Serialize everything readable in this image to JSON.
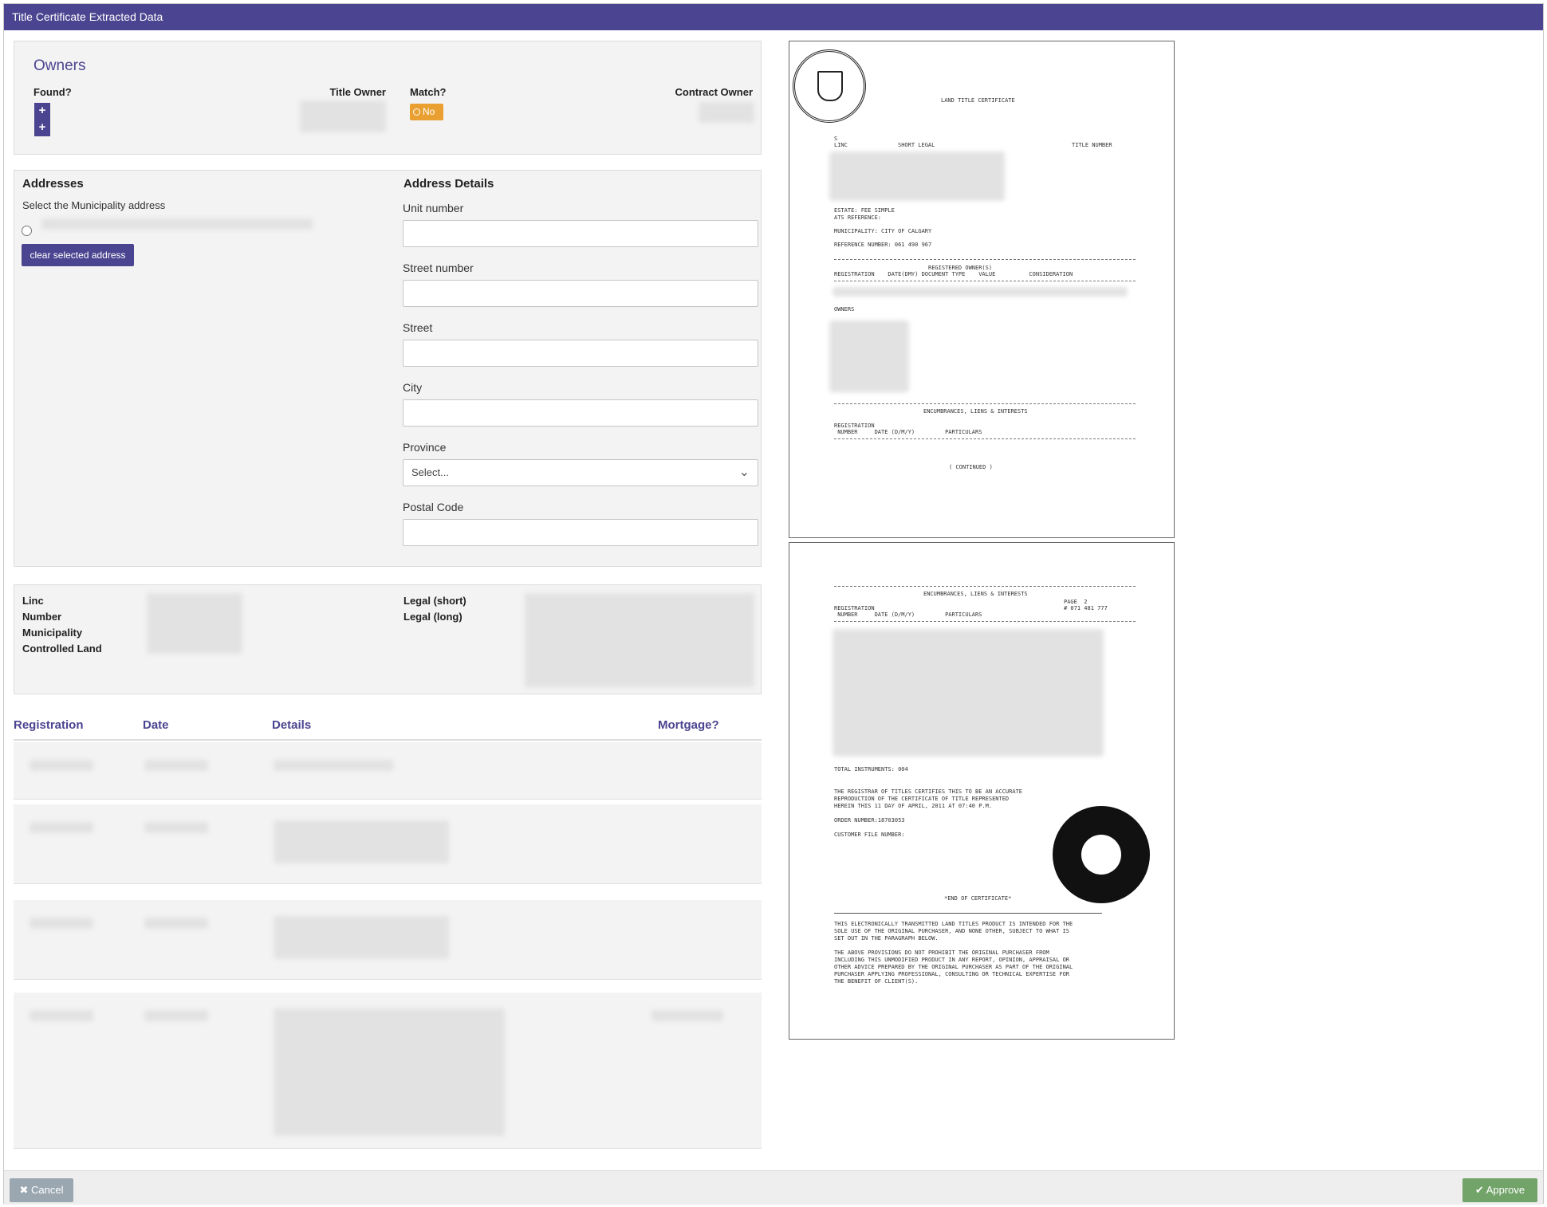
{
  "window": {
    "title": "Title Certificate Extracted Data"
  },
  "owners": {
    "title": "Owners",
    "found_label": "Found?",
    "title_owner_label": "Title Owner",
    "match_label": "Match?",
    "contract_owner_label": "Contract Owner",
    "plus_symbol": "+",
    "match_badge": "No"
  },
  "addresses": {
    "title": "Addresses",
    "instruction": "Select the Municipality address",
    "clear_button": "clear selected address"
  },
  "address_details": {
    "title": "Address Details",
    "unit_label": "Unit number",
    "street_number_label": "Street number",
    "street_label": "Street",
    "city_label": "City",
    "province_label": "Province",
    "province_value": "Select...",
    "postal_label": "Postal Code"
  },
  "legal": {
    "linc_label": "Linc",
    "number_label": "Number",
    "municipality_label": "Municipality",
    "controlled_label": "Controlled Land",
    "legal_short_label": "Legal (short)",
    "legal_long_label": "Legal (long)"
  },
  "registrations": {
    "headers": [
      "Registration",
      "Date",
      "Details",
      "Mortgage?"
    ]
  },
  "document": {
    "page1": {
      "heading": "LAND TITLE CERTIFICATE",
      "s": "S",
      "col_linc": "LINC",
      "col_short_legal": "SHORT LEGAL",
      "col_title_number": "TITLE NUMBER",
      "estate": "ESTATE: FEE SIMPLE",
      "ats": "ATS REFERENCE:",
      "municipality": "MUNICIPALITY: CITY OF CALGARY",
      "reference": "REFERENCE NUMBER: 061 490 967",
      "registered_owners": "REGISTERED OWNER(S)",
      "owner_cols": "REGISTRATION    DATE(DMY) DOCUMENT TYPE    VALUE          CONSIDERATION",
      "owners": "OWNERS",
      "encumbrances": "ENCUMBRANCES, LIENS & INTERESTS",
      "enc_reg": "REGISTRATION",
      "enc_cols": " NUMBER     DATE (D/M/Y)         PARTICULARS",
      "continued": "( CONTINUED )"
    },
    "page2": {
      "encumbrances": "ENCUMBRANCES, LIENS & INTERESTS",
      "page": "PAGE  2",
      "page_num": "# 071 481 777",
      "enc_reg": "REGISTRATION",
      "enc_cols": " NUMBER     DATE (D/M/Y)         PARTICULARS",
      "total": "TOTAL INSTRUMENTS: 004",
      "certify1": "THE REGISTRAR OF TITLES CERTIFIES THIS TO BE AN ACCURATE",
      "certify2": "REPRODUCTION OF THE CERTIFICATE OF TITLE REPRESENTED",
      "certify3": "HEREIN THIS 11 DAY OF APRIL, 2011 AT 07:40 P.M.",
      "order": "ORDER NUMBER:18703053",
      "customer": "CUSTOMER FILE NUMBER:",
      "end": "*END OF CERTIFICATE*",
      "notice1": "THIS ELECTRONICALLY TRANSMITTED LAND TITLES PRODUCT IS INTENDED FOR THE",
      "notice2": "SOLE USE OF THE ORIGINAL PURCHASER, AND NONE OTHER, SUBJECT TO WHAT IS",
      "notice3": "SET OUT IN THE PARAGRAPH BELOW.",
      "notice4": "THE ABOVE PROVISIONS DO NOT PROHIBIT THE ORIGINAL PURCHASER FROM",
      "notice5": "INCLUDING THIS UNMODIFIED PRODUCT IN ANY REPORT, OPINION, APPRAISAL OR",
      "notice6": "OTHER ADVICE PREPARED BY THE ORIGINAL PURCHASER AS PART OF THE ORIGINAL",
      "notice7": "PURCHASER APPLYING PROFESSIONAL, CONSULTING OR TECHNICAL EXPERTISE FOR",
      "notice8": "THE BENEFIT OF CLIENT(S)."
    }
  },
  "footer": {
    "cancel": "Cancel",
    "cancel_icon": "✖",
    "approve": "Approve",
    "approve_icon": "✔"
  },
  "colors": {
    "brand": "#4b4490",
    "warning": "#e9a030",
    "success": "#72a46a",
    "muted": "#9aa7b1"
  }
}
